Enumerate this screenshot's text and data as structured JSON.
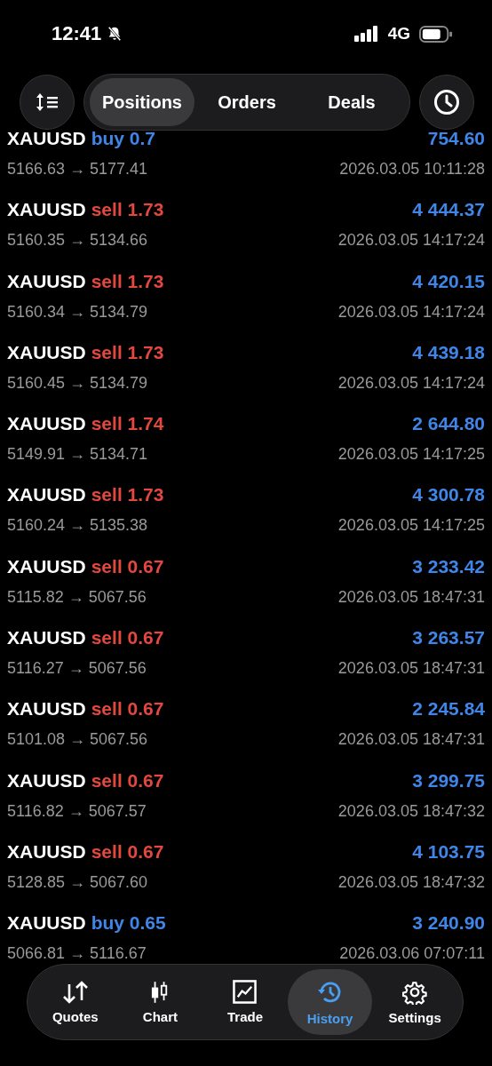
{
  "status_bar": {
    "time": "12:41",
    "network": "4G"
  },
  "header": {
    "tabs": [
      {
        "label": "Positions",
        "selected": true
      },
      {
        "label": "Orders",
        "selected": false
      },
      {
        "label": "Deals",
        "selected": false
      }
    ]
  },
  "deals": [
    {
      "symbol": "XAUUSD",
      "side": "buy",
      "volume": "0.7",
      "profit": "754.60",
      "prices": "5166.63 → 5177.41",
      "time": "2026.03.05 10:11:28"
    },
    {
      "symbol": "XAUUSD",
      "side": "sell",
      "volume": "1.73",
      "profit": "4 444.37",
      "prices": "5160.35 → 5134.66",
      "time": "2026.03.05 14:17:24"
    },
    {
      "symbol": "XAUUSD",
      "side": "sell",
      "volume": "1.73",
      "profit": "4 420.15",
      "prices": "5160.34 → 5134.79",
      "time": "2026.03.05 14:17:24"
    },
    {
      "symbol": "XAUUSD",
      "side": "sell",
      "volume": "1.73",
      "profit": "4 439.18",
      "prices": "5160.45 → 5134.79",
      "time": "2026.03.05 14:17:24"
    },
    {
      "symbol": "XAUUSD",
      "side": "sell",
      "volume": "1.74",
      "profit": "2 644.80",
      "prices": "5149.91 → 5134.71",
      "time": "2026.03.05 14:17:25"
    },
    {
      "symbol": "XAUUSD",
      "side": "sell",
      "volume": "1.73",
      "profit": "4 300.78",
      "prices": "5160.24 → 5135.38",
      "time": "2026.03.05 14:17:25"
    },
    {
      "symbol": "XAUUSD",
      "side": "sell",
      "volume": "0.67",
      "profit": "3 233.42",
      "prices": "5115.82 → 5067.56",
      "time": "2026.03.05 18:47:31"
    },
    {
      "symbol": "XAUUSD",
      "side": "sell",
      "volume": "0.67",
      "profit": "3 263.57",
      "prices": "5116.27 → 5067.56",
      "time": "2026.03.05 18:47:31"
    },
    {
      "symbol": "XAUUSD",
      "side": "sell",
      "volume": "0.67",
      "profit": "2 245.84",
      "prices": "5101.08 → 5067.56",
      "time": "2026.03.05 18:47:31"
    },
    {
      "symbol": "XAUUSD",
      "side": "sell",
      "volume": "0.67",
      "profit": "3 299.75",
      "prices": "5116.82 → 5067.57",
      "time": "2026.03.05 18:47:32"
    },
    {
      "symbol": "XAUUSD",
      "side": "sell",
      "volume": "0.67",
      "profit": "4 103.75",
      "prices": "5128.85 → 5067.60",
      "time": "2026.03.05 18:47:32"
    },
    {
      "symbol": "XAUUSD",
      "side": "buy",
      "volume": "0.65",
      "profit": "3 240.90",
      "prices": "5066.81 → 5116.67",
      "time": "2026.03.06 07:07:11"
    }
  ],
  "nav": [
    {
      "kind": "quotes",
      "label": "Quotes",
      "selected": false
    },
    {
      "kind": "chart",
      "label": "Chart",
      "selected": false
    },
    {
      "kind": "trade",
      "label": "Trade",
      "selected": false
    },
    {
      "kind": "history",
      "label": "History",
      "selected": true
    },
    {
      "kind": "settings",
      "label": "Settings",
      "selected": false
    }
  ]
}
